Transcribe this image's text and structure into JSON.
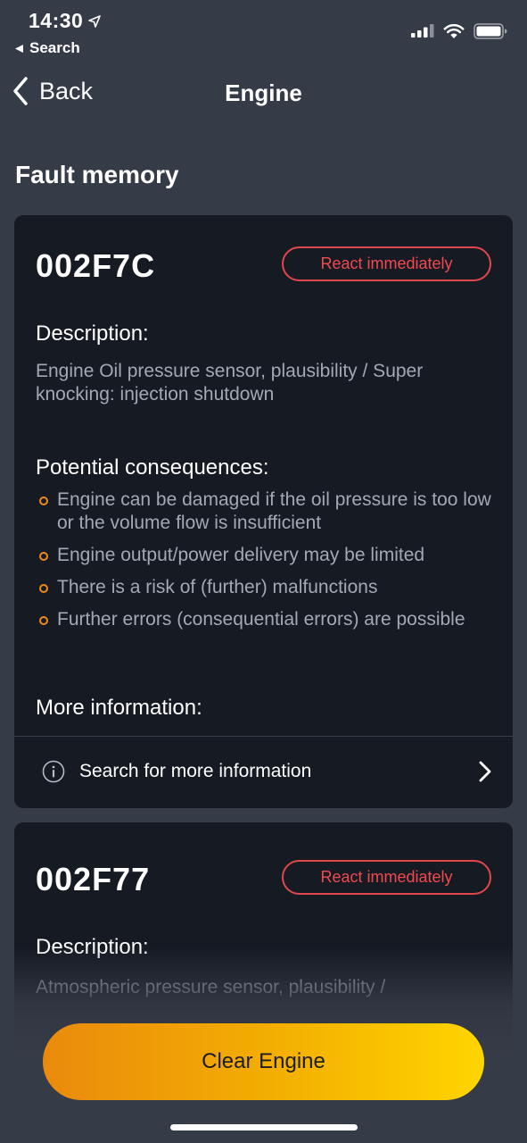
{
  "status_bar": {
    "time": "14:30",
    "back_app": "Search"
  },
  "nav": {
    "back_label": "Back",
    "title": "Engine"
  },
  "section_title": "Fault memory",
  "faults": [
    {
      "code": "002F7C",
      "badge": "React immediately",
      "description_label": "Description:",
      "description": "Engine Oil pressure sensor, plausibility / Super knocking: injection shutdown",
      "consequences_label": "Potential consequences:",
      "consequences": [
        "Engine can be damaged if the oil pressure is too low or the volume flow is insufficient",
        "Engine output/power delivery may be limited",
        "There is a risk of (further) malfunctions",
        "Further errors (consequential errors) are possible"
      ],
      "more_info_label": "More information:",
      "more_info_link": "Search for more information"
    },
    {
      "code": "002F77",
      "badge": "React immediately",
      "description_label": "Description:",
      "description": "Atmospheric pressure sensor, plausibility /"
    }
  ],
  "clear_button": "Clear Engine",
  "colors": {
    "background": "#363b48",
    "card": "#161a23",
    "badge_red": "#f04a50",
    "bullet_orange": "#f08a1c",
    "button_start": "#ea8a0d",
    "button_end": "#ffd500"
  },
  "icons": {
    "location": "location-arrow-icon",
    "back_triangle": "back-triangle-icon",
    "signal": "cellular-signal-icon",
    "wifi": "wifi-icon",
    "battery": "battery-icon",
    "chevron_left": "chevron-left-icon",
    "info": "info-icon",
    "chevron_right": "chevron-right-icon"
  }
}
